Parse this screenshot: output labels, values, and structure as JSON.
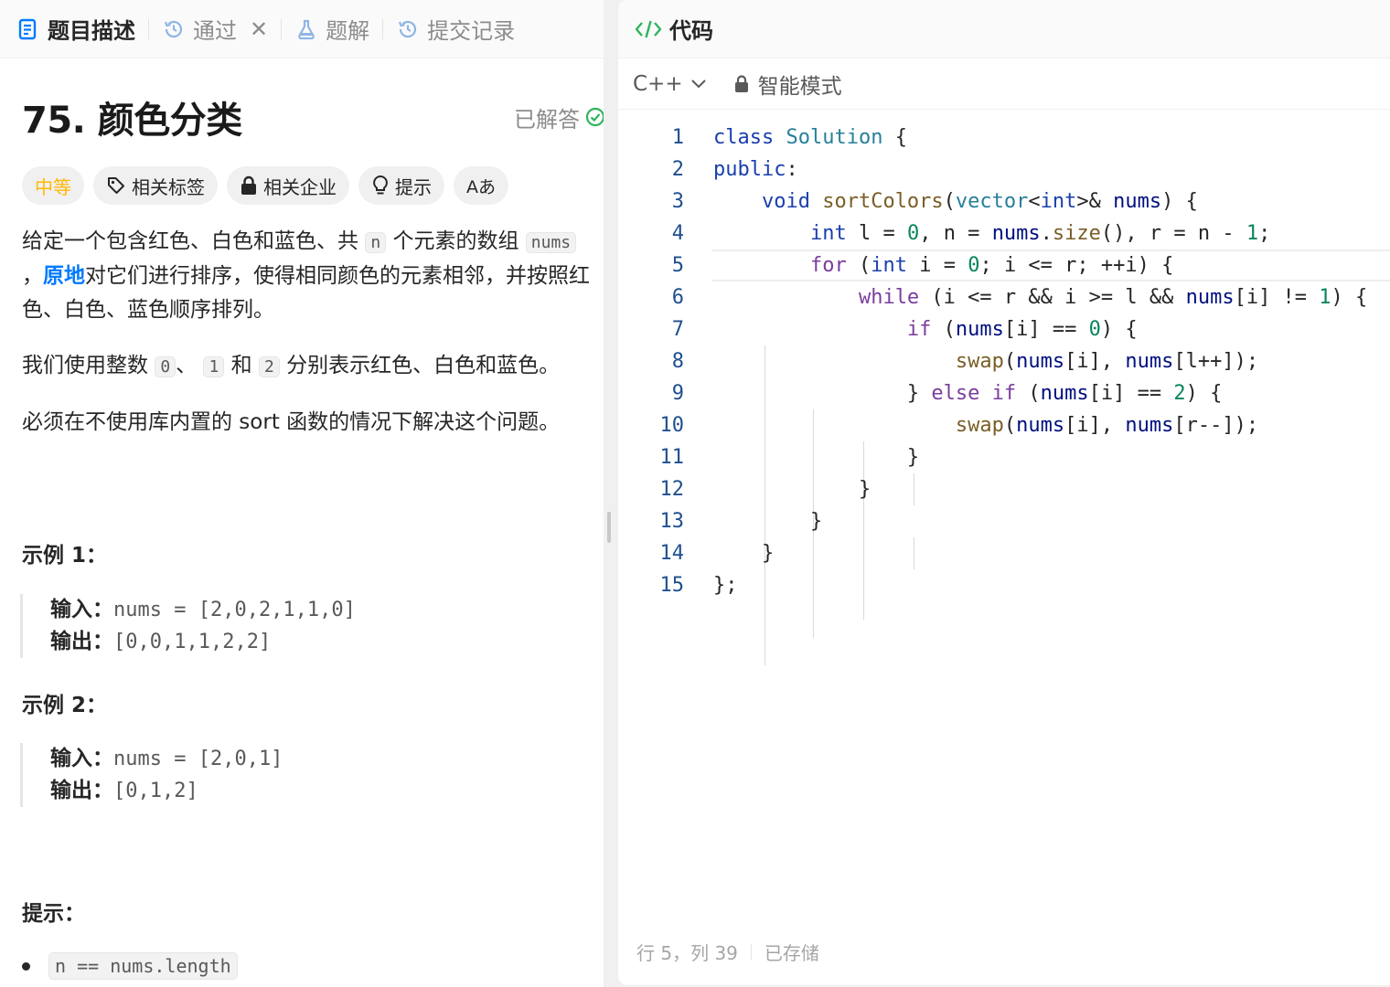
{
  "left_tabs": [
    {
      "label": "题目描述",
      "icon": "description-icon"
    },
    {
      "label": "通过",
      "icon": "history-icon"
    },
    {
      "label": "题解",
      "icon": "flask-icon"
    },
    {
      "label": "提交记录",
      "icon": "history-icon"
    }
  ],
  "problem": {
    "title": "75. 颜色分类",
    "status": "已解答",
    "difficulty": "中等",
    "tags": [
      "相关标签",
      "相关企业",
      "提示"
    ],
    "font_button": "Aあ",
    "desc1": {
      "a": "给定一个包含红色、白色和蓝色、共 ",
      "n": "n",
      "b": " 个元素的数组 ",
      "nums": "nums",
      "c": " ，",
      "link": "原地",
      "d": "对它们进行排序，使得相同颜色的元素相邻，并按照红色、白色、蓝色顺序排列。"
    },
    "desc2": {
      "a": "我们使用整数 ",
      "v0": "0",
      "b": "、 ",
      "v1": "1",
      "c": " 和 ",
      "v2": "2",
      "d": " 分别表示红色、白色和蓝色。"
    },
    "desc3": "必须在不使用库内置的 sort 函数的情况下解决这个问题。",
    "examples": [
      {
        "title": "示例 1：",
        "input_label": "输入：",
        "input": "nums = [2,0,2,1,1,0]",
        "output_label": "输出：",
        "output": "[0,0,1,1,2,2]"
      },
      {
        "title": "示例 2：",
        "input_label": "输入：",
        "input": "nums = [2,0,1]",
        "output_label": "输出：",
        "output": "[0,1,2]"
      }
    ],
    "hints_title": "提示：",
    "constraint": "n == nums.length"
  },
  "code_panel": {
    "title": "代码",
    "language": "C++",
    "mode": "智能模式",
    "line_numbers": [
      "1",
      "2",
      "3",
      "4",
      "5",
      "6",
      "7",
      "8",
      "9",
      "10",
      "11",
      "12",
      "13",
      "14",
      "15"
    ],
    "status_position": "行 5，列 39",
    "status_saved": "已存储"
  },
  "colors": {
    "accent_blue": "#007aff",
    "difficulty_medium": "#ffb800",
    "solved_green": "#2db55d"
  }
}
